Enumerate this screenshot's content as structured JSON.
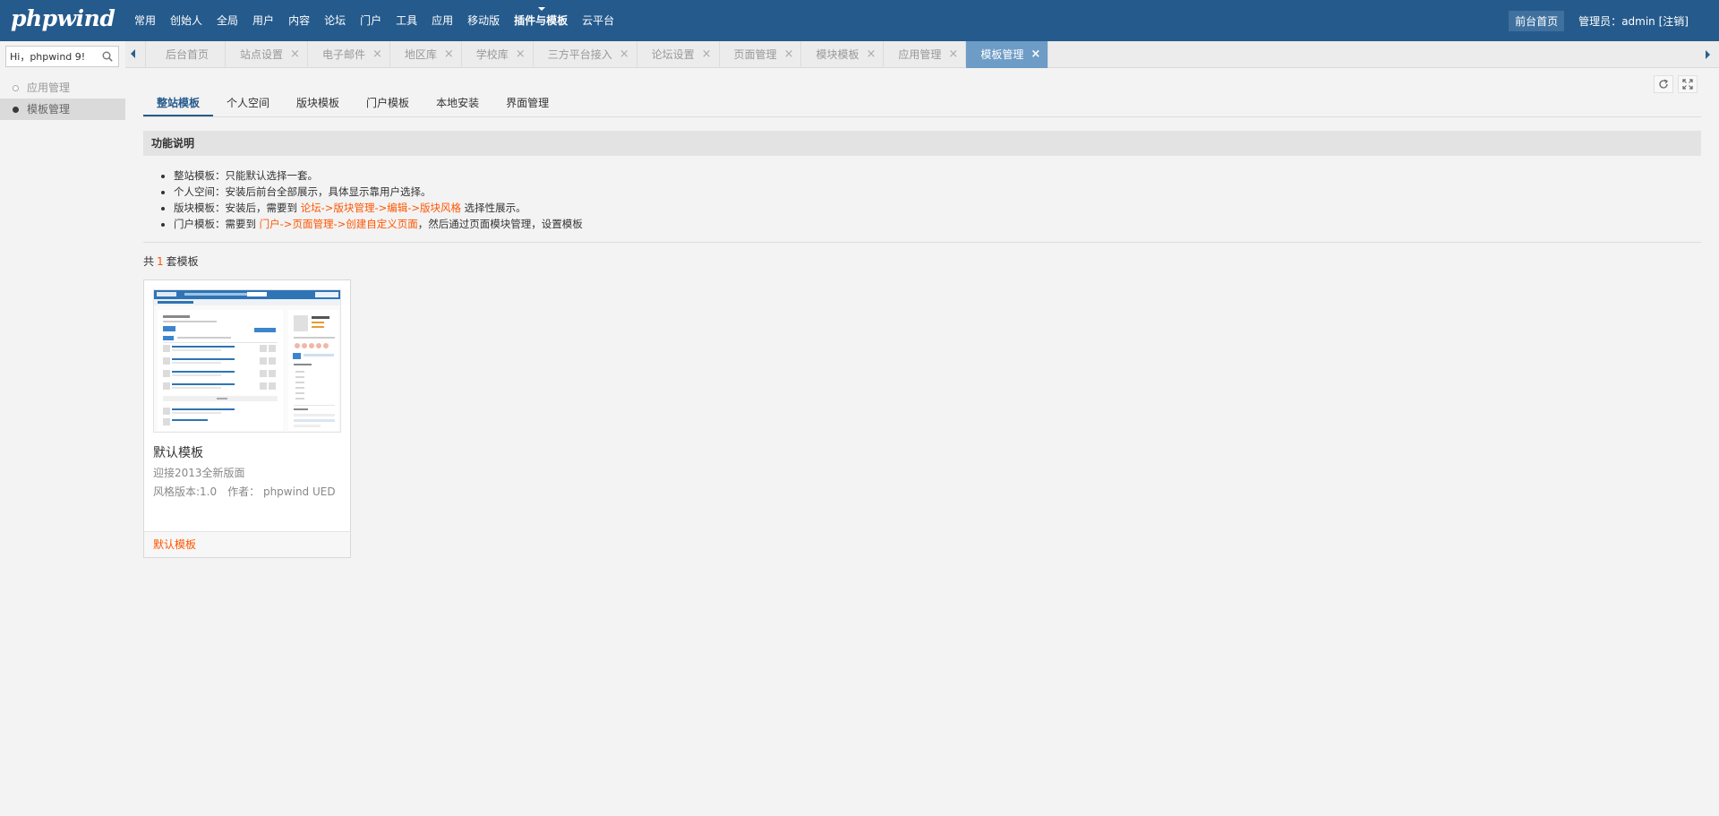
{
  "logo": "phpwind",
  "topnav": [
    {
      "label": "常用"
    },
    {
      "label": "创始人"
    },
    {
      "label": "全局"
    },
    {
      "label": "用户"
    },
    {
      "label": "内容"
    },
    {
      "label": "论坛"
    },
    {
      "label": "门户"
    },
    {
      "label": "工具"
    },
    {
      "label": "应用"
    },
    {
      "label": "移动版"
    },
    {
      "label": "插件与模板",
      "active": true
    },
    {
      "label": "云平台"
    }
  ],
  "header": {
    "front_link": "前台首页",
    "admin_prefix": "管理员：",
    "admin_name": "admin",
    "logout": "[注销]"
  },
  "sidebar": {
    "search_value": "Hi，phpwind 9!",
    "items": [
      {
        "label": "应用管理",
        "active": false
      },
      {
        "label": "模板管理",
        "active": true
      }
    ]
  },
  "tabs": [
    {
      "label": "后台首页",
      "closable": false
    },
    {
      "label": "站点设置",
      "closable": true
    },
    {
      "label": "电子邮件",
      "closable": true
    },
    {
      "label": "地区库",
      "closable": true
    },
    {
      "label": "学校库",
      "closable": true
    },
    {
      "label": "三方平台接入",
      "closable": true
    },
    {
      "label": "论坛设置",
      "closable": true
    },
    {
      "label": "页面管理",
      "closable": true
    },
    {
      "label": "模块模板",
      "closable": true
    },
    {
      "label": "应用管理",
      "closable": true
    },
    {
      "label": "模板管理",
      "closable": true,
      "active": true
    }
  ],
  "close_glyph": "×",
  "subtabs": [
    {
      "label": "整站模板",
      "active": true
    },
    {
      "label": "个人空间"
    },
    {
      "label": "版块模板"
    },
    {
      "label": "门户模板"
    },
    {
      "label": "本地安装"
    },
    {
      "label": "界面管理"
    }
  ],
  "info": {
    "title": "功能说明",
    "line1": "整站模板：只能默认选择一套。",
    "line2": "个人空间：安装后前台全部展示，具体显示靠用户选择。",
    "line3_pre": "版块模板：安装后，需要到 ",
    "line3_link": "论坛->版块管理->编辑->版块风格",
    "line3_post": " 选择性展示。",
    "line4_pre": "门户模板：需要到 ",
    "line4_link": "门户->页面管理->创建自定义页面",
    "line4_post": "，然后通过页面模块管理，设置模板"
  },
  "count": {
    "pre": "共",
    "num": "1",
    "post": "套模板"
  },
  "template_card": {
    "name": "默认模板",
    "desc": "迎接2013全新版面",
    "version": "风格版本:1.0",
    "author": "作者： phpwind UED",
    "status": "默认模板"
  },
  "colors": {
    "topbar": "#255a8c",
    "active_tab": "#6d9cc6",
    "link": "#ff5500"
  }
}
